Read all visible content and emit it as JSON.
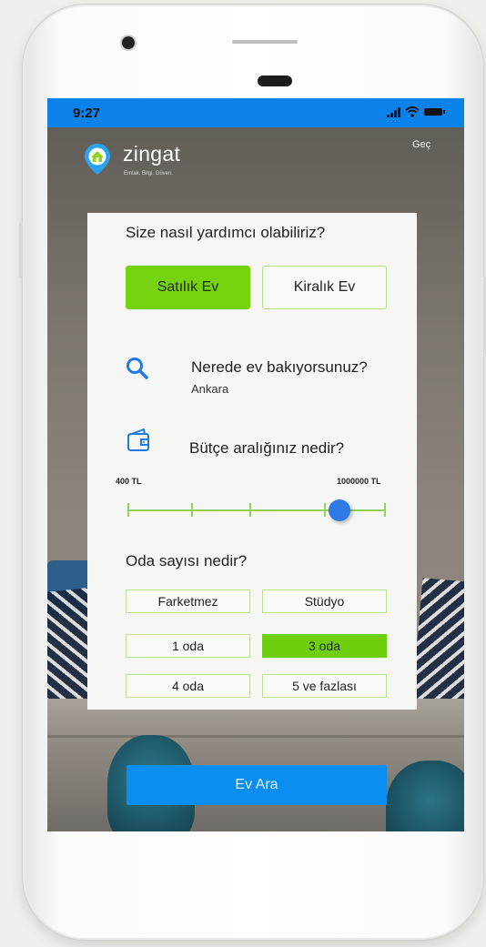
{
  "status_bar": {
    "time": "9:27"
  },
  "header": {
    "logo_text": "zingat",
    "tagline": "Emlak. Bilgi. Güven.",
    "skip_label": "Geç"
  },
  "card": {
    "title": "Size nasıl yardımcı olabiliriz?",
    "listing_types": [
      {
        "label": "Satılık Ev",
        "selected": true
      },
      {
        "label": "Kiralık Ev",
        "selected": false
      }
    ],
    "location": {
      "question": "Nerede ev bakıyorsunuz?",
      "value": "Ankara"
    },
    "budget": {
      "question": "Bütçe aralığınız nedir?",
      "min_label": "400 TL",
      "max_label": "1000000 TL",
      "thumb_fraction": 0.82
    },
    "rooms": {
      "question": "Oda sayısı nedir?",
      "options": [
        {
          "label": "Farketmez",
          "selected": false
        },
        {
          "label": "Stüdyo",
          "selected": false
        },
        {
          "label": "1 oda",
          "selected": false
        },
        {
          "label": "3 oda",
          "selected": true
        },
        {
          "label": "4 oda",
          "selected": false
        },
        {
          "label": "5 ve fazlası",
          "selected": false
        }
      ]
    }
  },
  "search_button": {
    "label": "Ev Ara"
  },
  "colors": {
    "status_bar": "#0a82ea",
    "accent_green": "#77d20f",
    "accent_blue": "#0a8ff0",
    "slider_thumb": "#2f7ae6",
    "icon_blue": "#1e7be3"
  }
}
